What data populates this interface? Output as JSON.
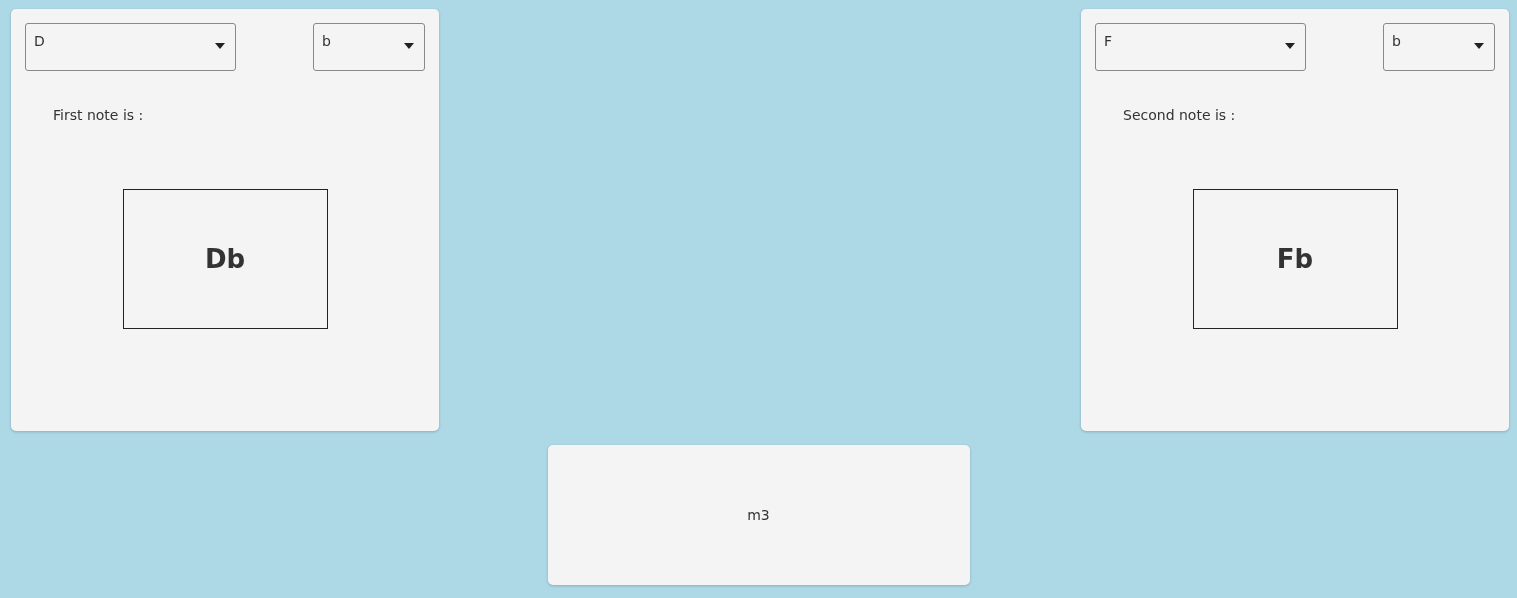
{
  "panels": [
    {
      "note_select": {
        "value": "D"
      },
      "accidental_select": {
        "value": "b"
      },
      "label": "First note is :",
      "result": "Db"
    },
    {
      "note_select": {
        "value": "F"
      },
      "accidental_select": {
        "value": "b"
      },
      "label": "Second note is :",
      "result": "Fb"
    }
  ],
  "interval": {
    "result": "m3"
  }
}
